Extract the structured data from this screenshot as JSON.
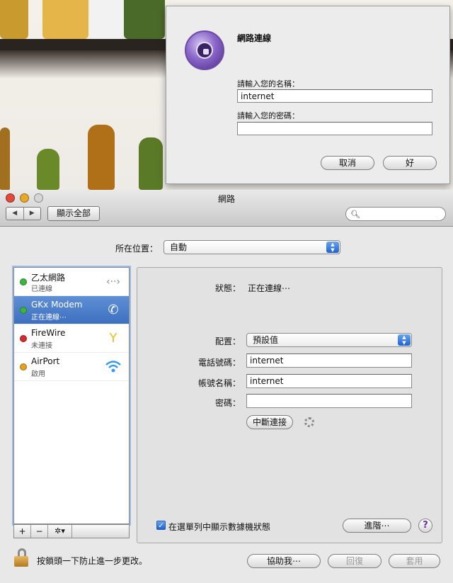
{
  "sheet": {
    "title": "網路連線",
    "name_label": "請輸入您的名稱：",
    "name_value": "internet",
    "password_label": "請輸入您的密碼：",
    "password_value": "",
    "cancel_label": "取消",
    "ok_label": "好"
  },
  "window": {
    "title": "網路",
    "back_glyph": "◀",
    "forward_glyph": "▶",
    "show_all_label": "顯示全部",
    "search_value": ""
  },
  "location": {
    "label": "所在位置：",
    "value": "自動"
  },
  "services": [
    {
      "name": "乙太網路",
      "status": "已連線",
      "dot_color": "#3db53d",
      "icon": "ethernet-icon",
      "selected": false
    },
    {
      "name": "GKx Modem",
      "status": "正在連線⋯",
      "dot_color": "#3db53d",
      "icon": "phone-modem-icon",
      "selected": true
    },
    {
      "name": "FireWire",
      "status": "未連接",
      "dot_color": "#d42b2b",
      "icon": "firewire-icon",
      "selected": false
    },
    {
      "name": "AirPort",
      "status": "啟用",
      "dot_color": "#e8a020",
      "icon": "wifi-icon",
      "selected": false
    }
  ],
  "list_tools": {
    "add": "+",
    "remove": "−",
    "gear": "✲▾"
  },
  "detail": {
    "status_label": "狀態：",
    "status_value": "正在連線⋯",
    "config_label": "配置：",
    "config_value": "預設值",
    "phone_label": "電話號碼：",
    "phone_value": "internet",
    "account_label": "帳號名稱：",
    "account_value": "internet",
    "password_label": "密碼：",
    "password_value": "",
    "disconnect_label": "中斷連接",
    "show_status_label": "在選單列中顯示數據機狀態",
    "show_status_checked": true,
    "advanced_label": "進階⋯",
    "help_label": "?"
  },
  "footer": {
    "lock_text": "按鎖頭一下防止進一步更改。",
    "assist_label": "協助我⋯",
    "revert_label": "回復",
    "apply_label": "套用"
  },
  "colors": {
    "accent": "#3d6fc0",
    "close": "#e04a3a",
    "minimize": "#e8a82a",
    "zoom": "#d6d6d6"
  }
}
